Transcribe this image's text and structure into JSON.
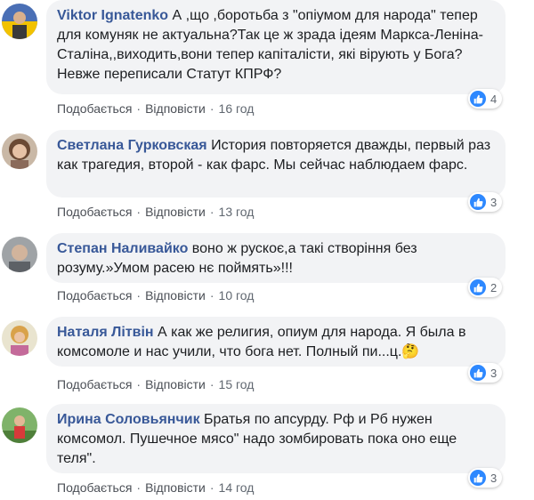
{
  "theme": {
    "author_color": "#385898",
    "bubble_bg": "#f2f3f5",
    "like_color": "#2d88ff"
  },
  "comments": [
    {
      "author": "Viktor Ignatenko",
      "text": "А ,що ,боротьба з \"опіумом для народа\" тепер для комуняк не актуальна?Так це ж зрада ідеям Маркса-Леніна-Сталіна,,виходить,вони тепер капіталісти, які вірують у Бога? Невже переписали Статут КПРФ?",
      "like": "Подобається",
      "reply": "Відповісти",
      "time": "16 год",
      "reactions": "4",
      "reaction_icon": "thumbs-up-icon"
    },
    {
      "author": "Светлана Гурковская",
      "text": "История повторяется дважды, первый раз как трагедия, второй - как фарс. Мы сейчас наблюдаем фарс.",
      "like": "Подобається",
      "reply": "Відповісти",
      "time": "13 год",
      "reactions": "3",
      "reaction_icon": "thumbs-up-icon"
    },
    {
      "author": "Степан Наливайко",
      "text": "воно ж рускоє,а такі створіння без розуму.»Умом расею нє поймять»!!!",
      "like": "Подобається",
      "reply": "Відповісти",
      "time": "10 год",
      "reactions": "2",
      "reaction_icon": "thumbs-up-icon"
    },
    {
      "author": "Наталя Літвін",
      "text": "А как же религия, опиум для народа. Я была в комсомоле и нас учили, что бога нет. Полный пи...ц.🤔",
      "like": "Подобається",
      "reply": "Відповісти",
      "time": "15 год",
      "reactions": "3",
      "reaction_icon": "thumbs-up-icon"
    },
    {
      "author": "Ирина Соловьянчик",
      "text": "Братья по апсурду. Рф и Рб нужен комсомол. Пушечное мясо\" надо зомбировать пока оно еще теля\".",
      "like": "Подобається",
      "reply": "Відповісти",
      "time": "14 год",
      "reactions": "3",
      "reaction_icon": "thumbs-up-icon"
    }
  ]
}
